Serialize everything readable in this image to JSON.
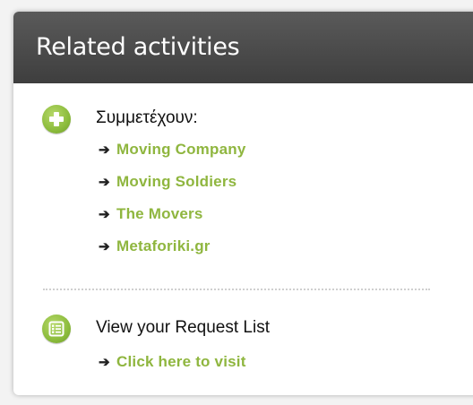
{
  "panel": {
    "title": "Related activities"
  },
  "participants": {
    "icon": "plus-icon",
    "title": "Συμμετέχουν:",
    "items": [
      {
        "arrow": "➔",
        "label": "Moving Company"
      },
      {
        "arrow": "➔",
        "label": "Moving Soldiers"
      },
      {
        "arrow": "➔",
        "label": "The Movers"
      },
      {
        "arrow": "➔",
        "label": "Metaforiki.gr"
      }
    ]
  },
  "request_list": {
    "icon": "list-icon",
    "title": "View your Request List",
    "link": {
      "arrow": "➔",
      "label": "Click here to visit"
    }
  },
  "colors": {
    "header_bg": "#4a4a4a",
    "accent_green": "#8cbc3c",
    "link_green": "#8fb63f"
  }
}
